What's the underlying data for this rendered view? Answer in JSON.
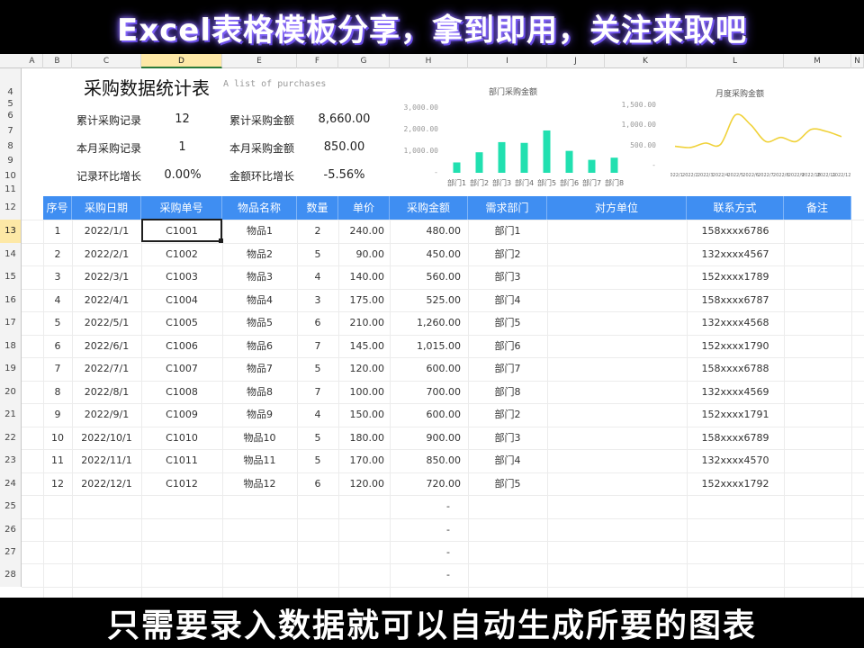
{
  "banners": {
    "top": "Excel表格模板分享，拿到即用，关注来取吧",
    "bottom": "只需要录入数据就可以自动生成所要的图表"
  },
  "column_headers": [
    "A",
    "B",
    "C",
    "D",
    "E",
    "F",
    "G",
    "H",
    "I",
    "J",
    "K",
    "L",
    "M",
    "N"
  ],
  "selected_column": "D",
  "row_numbers": [
    "4",
    "5",
    "6",
    "7",
    "8",
    "9",
    "10",
    "11",
    "12",
    "13",
    "14",
    "15",
    "16",
    "17",
    "18",
    "19",
    "20",
    "21",
    "22",
    "23",
    "24",
    "25",
    "26",
    "27",
    "28"
  ],
  "selected_row": "13",
  "sheet": {
    "title": "采购数据统计表",
    "subtitle": "A list of purchases",
    "stats": {
      "total_records_label": "累计采购记录",
      "total_records_value": "12",
      "total_amount_label": "累计采购金额",
      "total_amount_value": "8,660.00",
      "month_records_label": "本月采购记录",
      "month_records_value": "1",
      "month_amount_label": "本月采购金额",
      "month_amount_value": "850.00",
      "records_growth_label": "记录环比增长",
      "records_growth_value": "0.00%",
      "amount_growth_label": "金额环比增长",
      "amount_growth_value": "-5.56%"
    }
  },
  "chart_data": [
    {
      "type": "bar",
      "title": "部门采购金额",
      "categories": [
        "部门1",
        "部门2",
        "部门3",
        "部门4",
        "部门5",
        "部门6",
        "部门7",
        "部门8"
      ],
      "values": [
        480,
        950,
        1420,
        1385,
        1960,
        1015,
        600,
        700
      ],
      "ylim": [
        0,
        3000
      ],
      "yticks": [
        "3,000.00",
        "2,000.00",
        "1,000.00",
        "-"
      ],
      "color": "#21e0b0"
    },
    {
      "type": "line",
      "title": "月度采购金额",
      "categories": [
        "2022/1/1",
        "2022/2/1",
        "2022/3/1",
        "2022/4/1",
        "2022/5/1",
        "2022/6/1",
        "2022/7/1",
        "2022/8/1",
        "2022/9/1",
        "2022/10/1",
        "2022/11/1",
        "2022/12/1"
      ],
      "x_tick_labels": [
        "2022/1",
        "2022/2",
        "2022/3",
        "2022/4",
        "2022/5",
        "2022/6",
        "2022/7",
        "2022/8",
        "2022/9",
        "2022/10",
        "2022/11",
        "2022/12"
      ],
      "values": [
        480,
        450,
        560,
        525,
        1260,
        1015,
        600,
        700,
        600,
        900,
        850,
        720
      ],
      "ylim": [
        0,
        1500
      ],
      "yticks": [
        "1,500.00",
        "1,000.00",
        "500.00",
        "-"
      ],
      "color": "#f0d23a"
    }
  ],
  "table": {
    "headers": [
      "序号",
      "采购日期",
      "采购单号",
      "物品名称",
      "数量",
      "单价",
      "采购金额",
      "需求部门",
      "对方单位",
      "联系方式",
      "备注"
    ],
    "rows": [
      [
        "1",
        "2022/1/1",
        "C1001",
        "物品1",
        "2",
        "240.00",
        "480.00",
        "部门1",
        "",
        "158xxxx6786",
        ""
      ],
      [
        "2",
        "2022/2/1",
        "C1002",
        "物品2",
        "5",
        "90.00",
        "450.00",
        "部门2",
        "",
        "132xxxx4567",
        ""
      ],
      [
        "3",
        "2022/3/1",
        "C1003",
        "物品3",
        "4",
        "140.00",
        "560.00",
        "部门3",
        "",
        "152xxxx1789",
        ""
      ],
      [
        "4",
        "2022/4/1",
        "C1004",
        "物品4",
        "3",
        "175.00",
        "525.00",
        "部门4",
        "",
        "158xxxx6787",
        ""
      ],
      [
        "5",
        "2022/5/1",
        "C1005",
        "物品5",
        "6",
        "210.00",
        "1,260.00",
        "部门5",
        "",
        "132xxxx4568",
        ""
      ],
      [
        "6",
        "2022/6/1",
        "C1006",
        "物品6",
        "7",
        "145.00",
        "1,015.00",
        "部门6",
        "",
        "152xxxx1790",
        ""
      ],
      [
        "7",
        "2022/7/1",
        "C1007",
        "物品7",
        "5",
        "120.00",
        "600.00",
        "部门7",
        "",
        "158xxxx6788",
        ""
      ],
      [
        "8",
        "2022/8/1",
        "C1008",
        "物品8",
        "7",
        "100.00",
        "700.00",
        "部门8",
        "",
        "132xxxx4569",
        ""
      ],
      [
        "9",
        "2022/9/1",
        "C1009",
        "物品9",
        "4",
        "150.00",
        "600.00",
        "部门2",
        "",
        "152xxxx1791",
        ""
      ],
      [
        "10",
        "2022/10/1",
        "C1010",
        "物品10",
        "5",
        "180.00",
        "900.00",
        "部门3",
        "",
        "158xxxx6789",
        ""
      ],
      [
        "11",
        "2022/11/1",
        "C1011",
        "物品11",
        "5",
        "170.00",
        "850.00",
        "部门4",
        "",
        "132xxxx4570",
        ""
      ],
      [
        "12",
        "2022/12/1",
        "C1012",
        "物品12",
        "6",
        "120.00",
        "720.00",
        "部门5",
        "",
        "152xxxx1792",
        ""
      ]
    ],
    "empty_amount_placeholder": "-"
  }
}
